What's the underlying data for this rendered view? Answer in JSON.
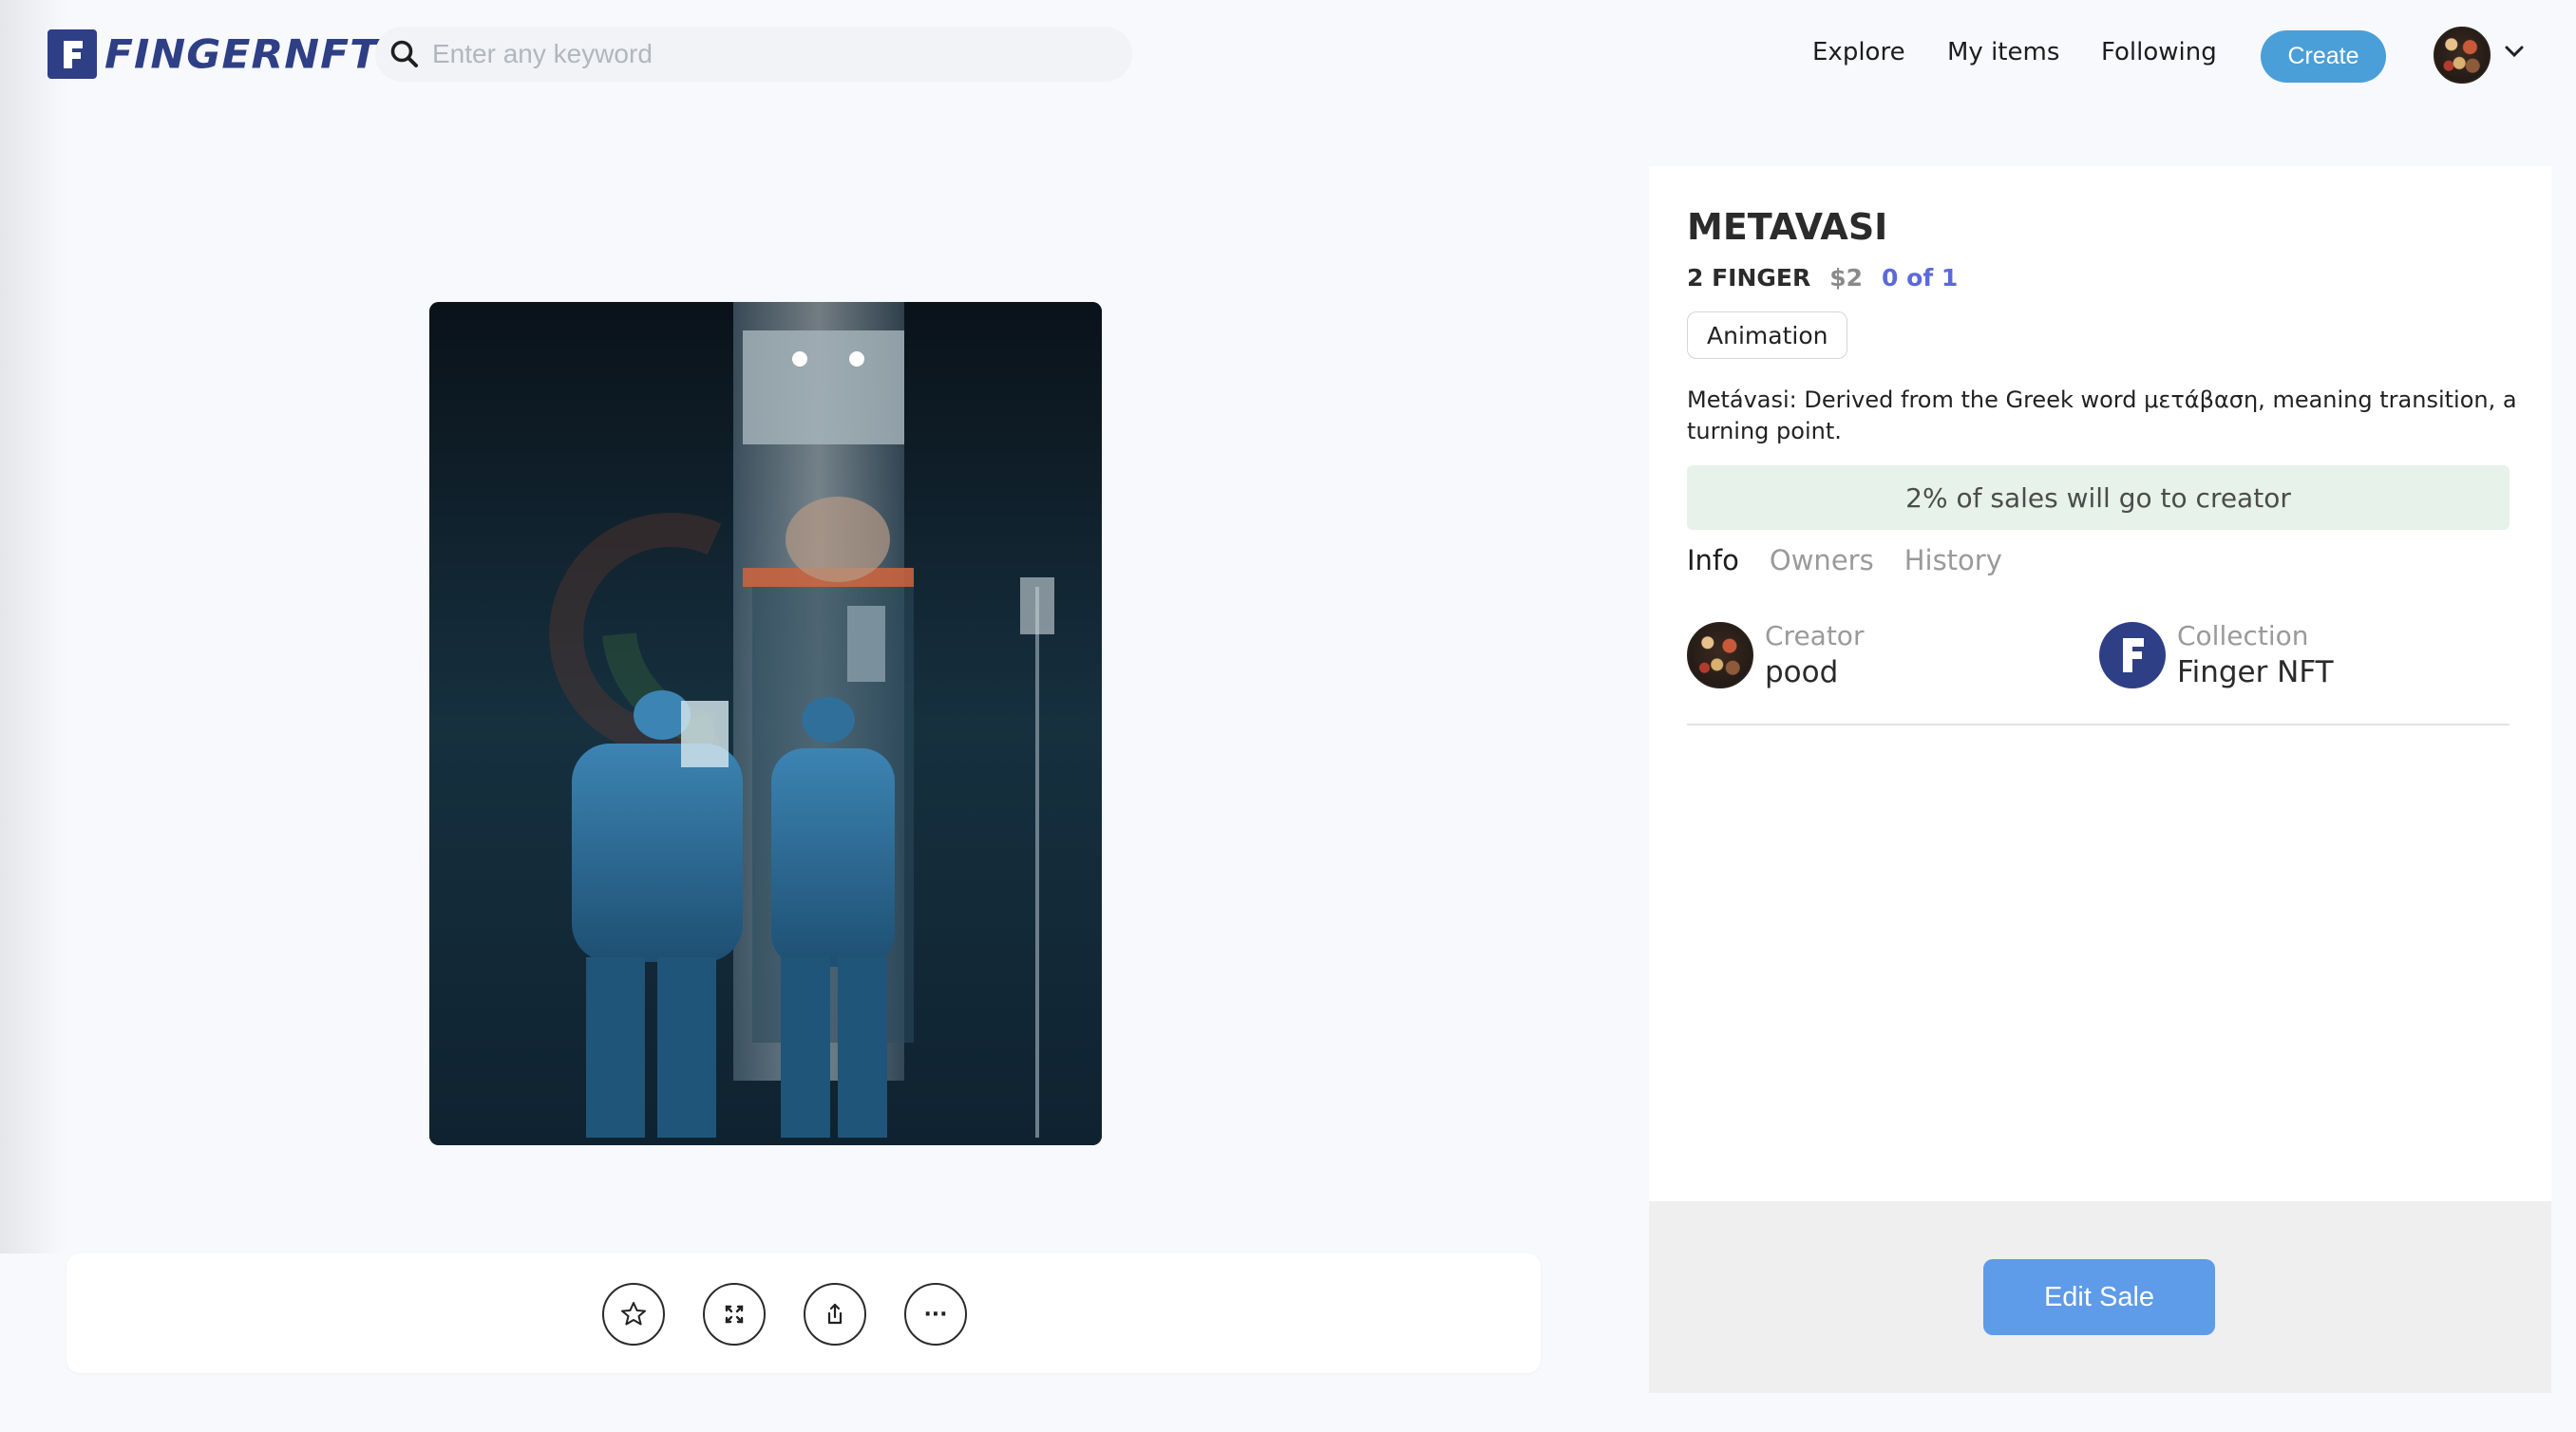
{
  "header": {
    "logo_text": "FINGERNFT",
    "search": {
      "placeholder": "Enter any keyword",
      "value": ""
    },
    "nav": {
      "explore": "Explore",
      "my_items": "My items",
      "following": "Following"
    },
    "create_label": "Create"
  },
  "toolbar": {
    "favorite_icon": "star-icon",
    "fullscreen_icon": "expand-icon",
    "share_icon": "share-icon",
    "more_label": "···"
  },
  "item": {
    "title": "METAVASI",
    "price_token": "2 FINGER",
    "price_usd": "$2",
    "edition": "0 of 1",
    "tag": "Animation",
    "description": "Metávasi: Derived from the Greek word μετάβαση, meaning transition, a turning point.",
    "royalty": "2% of sales will go to creator",
    "tabs": [
      "Info",
      "Owners",
      "History"
    ],
    "active_tab": "Info",
    "creator": {
      "label": "Creator",
      "value": "pood"
    },
    "collection": {
      "label": "Collection",
      "value": "Finger NFT"
    },
    "edit_sale_label": "Edit Sale"
  },
  "colors": {
    "brand": "#2e3f86",
    "create_button": "#4a9fd8",
    "edit_sale_button": "#5e9be8",
    "edition_text": "#5b6ad8",
    "royalty_bg": "#e6f2ea"
  }
}
